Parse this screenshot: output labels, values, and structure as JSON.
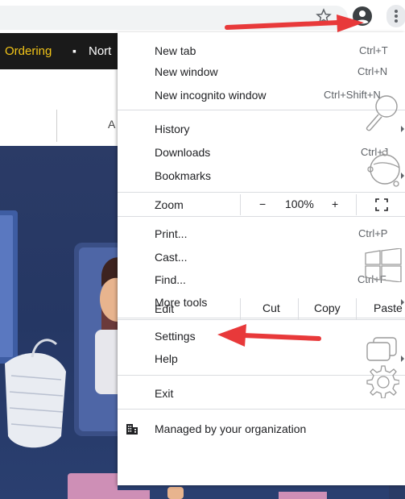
{
  "menu": {
    "new_tab": {
      "label": "New tab",
      "shortcut": "Ctrl+T"
    },
    "new_window": {
      "label": "New window",
      "shortcut": "Ctrl+N"
    },
    "new_incognito": {
      "label": "New incognito window",
      "shortcut": "Ctrl+Shift+N"
    },
    "history": {
      "label": "History"
    },
    "downloads": {
      "label": "Downloads",
      "shortcut": "Ctrl+J"
    },
    "bookmarks": {
      "label": "Bookmarks"
    },
    "zoom": {
      "label": "Zoom",
      "minus": "−",
      "level": "100%",
      "plus": "+"
    },
    "print": {
      "label": "Print...",
      "shortcut": "Ctrl+P"
    },
    "cast": {
      "label": "Cast..."
    },
    "find": {
      "label": "Find...",
      "shortcut": "Ctrl+F"
    },
    "more_tools": {
      "label": "More tools"
    },
    "edit": {
      "label": "Edit",
      "cut": "Cut",
      "copy": "Copy",
      "paste": "Paste"
    },
    "settings": {
      "label": "Settings"
    },
    "help": {
      "label": "Help"
    },
    "exit": {
      "label": "Exit"
    },
    "managed": {
      "label": "Managed by your organization",
      "icon": "building-icon"
    }
  },
  "page": {
    "nav_ordering": "Ordering",
    "nav_separator": "▪",
    "nav_north": "Nort",
    "sub_text": "A"
  },
  "annotations": {
    "arrow_color": "#e8393a"
  },
  "colors": {
    "nav_accent": "#f2c418",
    "nav_background": "#1a1a1a",
    "hero_background": "#2b3b66"
  }
}
